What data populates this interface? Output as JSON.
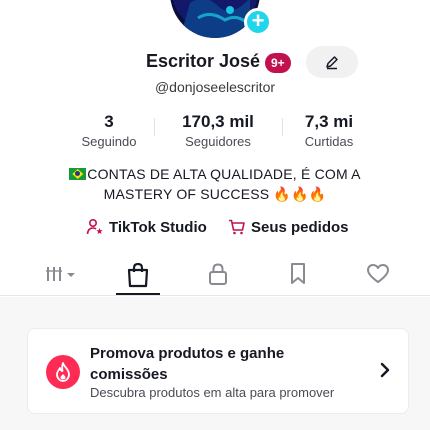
{
  "profile": {
    "display_name": "Escritor José",
    "notification_badge": "9+",
    "handle": "@donjoseelescritor",
    "stats": [
      {
        "value": "3",
        "label": "Seguindo"
      },
      {
        "value": "170,3 mil",
        "label": "Seguidores"
      },
      {
        "value": "7,3 mi",
        "label": "Curtidas"
      }
    ],
    "bio_line1": "CONTAS DE ALTA QUALIDADE, É COM A",
    "bio_line2": "MASTERY OF SUCCESS 🔥🔥🔥",
    "links": [
      {
        "label": "TikTok Studio",
        "icon": "person-star-icon"
      },
      {
        "label": "Seus pedidos",
        "icon": "cart-icon"
      }
    ]
  },
  "tabs": [
    {
      "name": "tab-grid",
      "icon": "grid-bars-icon",
      "active": false
    },
    {
      "name": "tab-shop",
      "icon": "shopping-bag-icon",
      "active": true
    },
    {
      "name": "tab-private",
      "icon": "lock-icon",
      "active": false
    },
    {
      "name": "tab-saved",
      "icon": "bookmark-icon",
      "active": false
    },
    {
      "name": "tab-liked",
      "icon": "heart-icon",
      "active": false
    }
  ],
  "promo": {
    "title": "Promova produtos e ganhe comissões",
    "subtitle": "Descubra produtos em alta para promover",
    "icon": "flame-icon"
  },
  "colors": {
    "accent": "#fe2c55",
    "badge": "#c1124f",
    "add_badge": "#20d5ec",
    "text": "#161823"
  }
}
